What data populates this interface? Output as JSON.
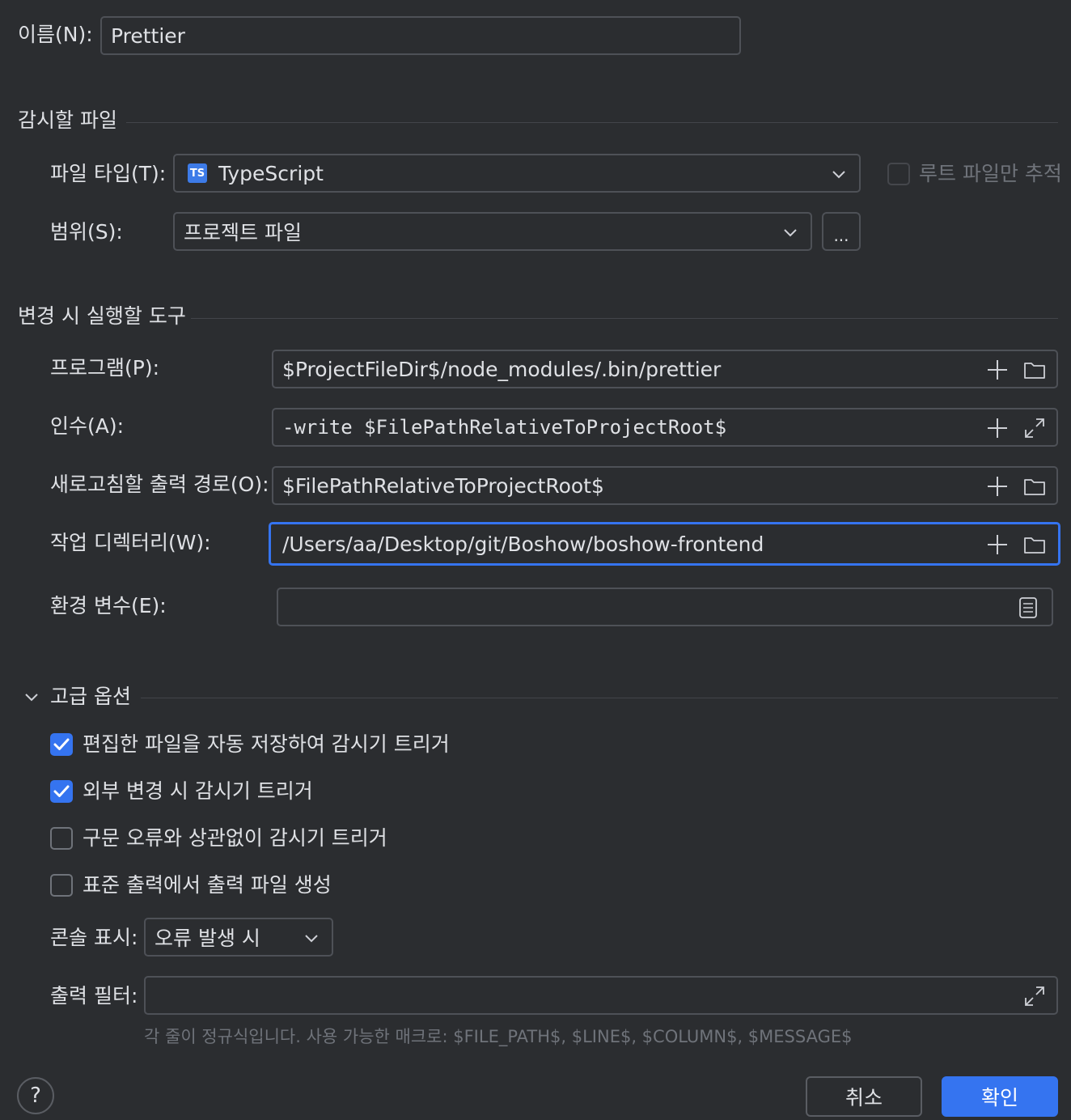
{
  "name": {
    "label": "이름(N):",
    "value": "Prettier"
  },
  "watch_files": {
    "section_title": "감시할 파일",
    "file_type_label": "파일 타입(T):",
    "file_type_icon_text": "TS",
    "file_type_value": "TypeScript",
    "root_only_label": "루트 파일만 추적",
    "scope_label": "범위(S):",
    "scope_value": "프로젝트 파일",
    "scope_more_label": "..."
  },
  "tool": {
    "section_title": "변경 시 실행할 도구",
    "program_label": "프로그램(P):",
    "program_value": "$ProjectFileDir$/node_modules/.bin/prettier",
    "args_label": "인수(A):",
    "args_value": "-write $FilePathRelativeToProjectRoot$",
    "output_paths_label": "새로고침할 출력 경로(O):",
    "output_paths_value": "$FilePathRelativeToProjectRoot$",
    "workdir_label": "작업 디렉터리(W):",
    "workdir_value": "/Users/aa/Desktop/git/Boshow/boshow-frontend",
    "env_label": "환경 변수(E):",
    "env_value": ""
  },
  "advanced": {
    "section_title": "고급 옵션",
    "options": [
      {
        "label": "편집한 파일을 자동 저장하여 감시기 트리거",
        "checked": true
      },
      {
        "label": "외부 변경 시 감시기 트리거",
        "checked": true
      },
      {
        "label": "구문 오류와 상관없이 감시기 트리거",
        "checked": false
      },
      {
        "label": "표준 출력에서 출력 파일 생성",
        "checked": false
      }
    ],
    "console_label": "콘솔 표시:",
    "console_value": "오류 발생 시",
    "output_filter_label": "출력 필터:",
    "output_filter_value": "",
    "hint": "각 줄이 정규식입니다. 사용 가능한 매크로: $FILE_PATH$, $LINE$, $COLUMN$, $MESSAGE$"
  },
  "footer": {
    "help_label": "?",
    "cancel_label": "취소",
    "ok_label": "확인"
  },
  "colors": {
    "accent": "#3574f0",
    "background": "#2b2d30",
    "border": "#4e5157",
    "ts_badge": "#3d7be8"
  }
}
